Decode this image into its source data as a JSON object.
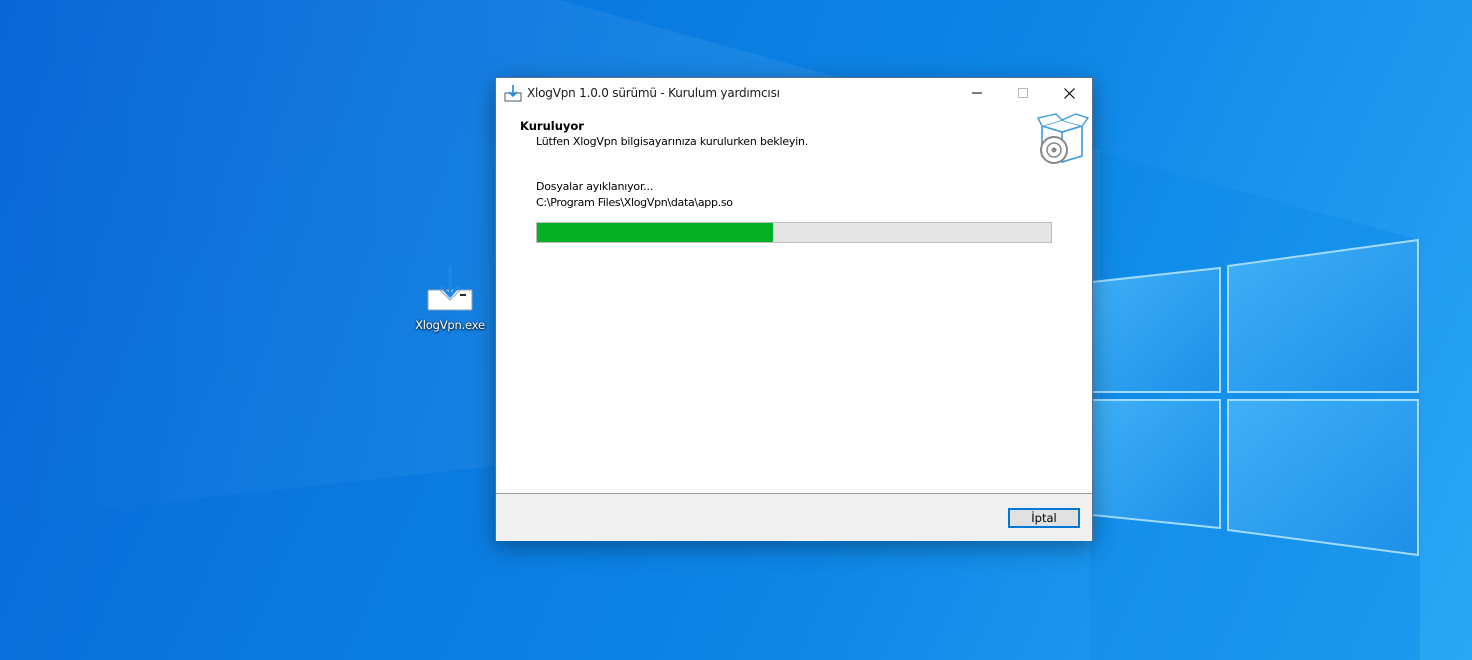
{
  "desktop": {
    "icons": [
      {
        "label": "XlogVpn.exe",
        "icon": "installer-icon"
      }
    ]
  },
  "window": {
    "title": "XlogVpn 1.0.0 sürümü - Kurulum yardımcısı",
    "title_icon": "setup-download-icon",
    "controls": [
      "minimize",
      "maximize",
      "close"
    ],
    "header": {
      "title": "Kuruluyor",
      "subtitle": "Lütfen XlogVpn bilgisayarınıza kurulurken bekleyin.",
      "image": "software-box-disc-icon"
    },
    "status": {
      "text": "Dosyalar ayıklanıyor...",
      "path": "C:\\Program Files\\XlogVpn\\data\\app.so"
    },
    "progress": {
      "fraction": 0.46,
      "color": "#06b025"
    },
    "footer": {
      "cancel_label": "İptal"
    }
  },
  "colors": {
    "accent": "#0078d7",
    "desktop_blue": "#0a7ae0"
  }
}
